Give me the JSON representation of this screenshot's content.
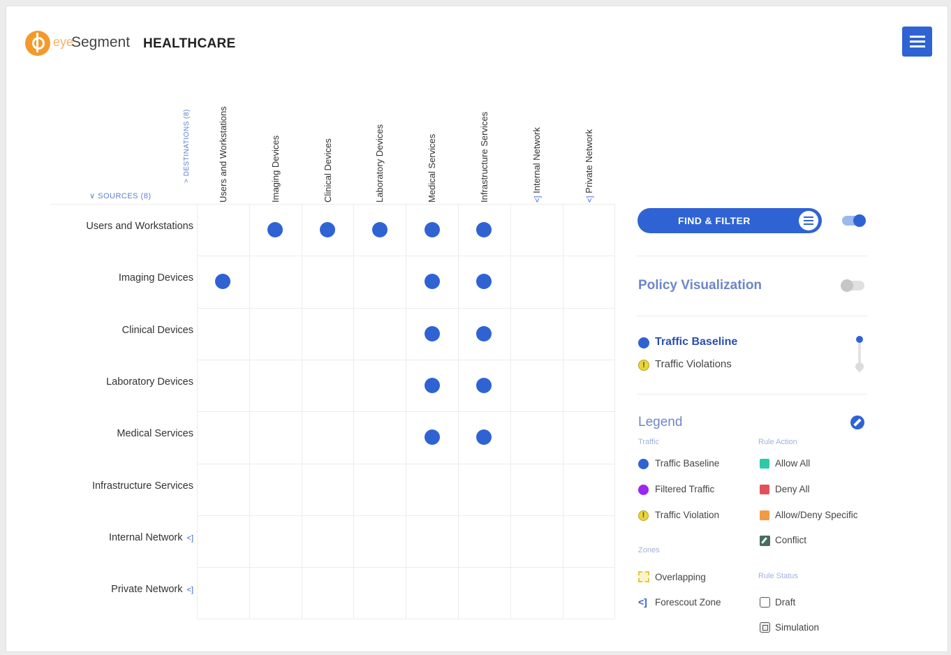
{
  "brand": {
    "eye": "eye",
    "segment": "Segment",
    "product": "HEALTHCARE"
  },
  "axis_labels": {
    "destinations": "> DESTINATIONS (8)",
    "sources": "∨ SOURCES (8)"
  },
  "zone_marker": "<]",
  "columns": [
    {
      "label": "Users and Workstations",
      "zone": false
    },
    {
      "label": "Imaging Devices",
      "zone": false
    },
    {
      "label": "Clinical Devices",
      "zone": false
    },
    {
      "label": "Laboratory Devices",
      "zone": false
    },
    {
      "label": "Medical Services",
      "zone": false
    },
    {
      "label": "Infrastructure Services",
      "zone": false
    },
    {
      "label": "Internal Network",
      "zone": true
    },
    {
      "label": "Private Network",
      "zone": true
    }
  ],
  "rows": [
    {
      "label": "Users and Workstations",
      "zone": false,
      "traffic_to": [
        1,
        2,
        3,
        4,
        5
      ]
    },
    {
      "label": "Imaging Devices",
      "zone": false,
      "traffic_to": [
        0,
        4,
        5
      ]
    },
    {
      "label": "Clinical Devices",
      "zone": false,
      "traffic_to": [
        4,
        5
      ]
    },
    {
      "label": "Laboratory Devices",
      "zone": false,
      "traffic_to": [
        4,
        5
      ]
    },
    {
      "label": "Medical Services",
      "zone": false,
      "traffic_to": [
        4,
        5
      ]
    },
    {
      "label": "Infrastructure Services",
      "zone": false,
      "traffic_to": []
    },
    {
      "label": "Internal Network",
      "zone": true,
      "traffic_to": []
    },
    {
      "label": "Private Network",
      "zone": true,
      "traffic_to": []
    }
  ],
  "sidebar": {
    "find_filter_label": "FIND & FILTER",
    "find_filter_toggle_on": true,
    "policy_visualization": "Policy Visualization",
    "policy_visualization_on": false,
    "traffic_baseline": "Traffic Baseline",
    "traffic_violations": "Traffic Violations",
    "violation_glyph": "!"
  },
  "legend": {
    "title": "Legend",
    "traffic_heading": "Traffic",
    "rule_action_heading": "Rule Action",
    "zones_heading": "Zones",
    "rule_status_heading": "Rule Status",
    "traffic": [
      "Traffic Baseline",
      "Filtered Traffic",
      "Traffic Violation"
    ],
    "rule_action": [
      "Allow All",
      "Deny All",
      "Allow/Deny Specific",
      "Conflict"
    ],
    "zones": [
      "Overlapping",
      "Forescout Zone"
    ],
    "rule_status": [
      "Draft",
      "Simulation"
    ]
  },
  "colors": {
    "accent": "#2f63d4",
    "filtered": "#9b27f2",
    "violation": "#e9d43c",
    "allow": "#2ec9a7",
    "deny": "#e2505c",
    "specific": "#f29a45"
  }
}
